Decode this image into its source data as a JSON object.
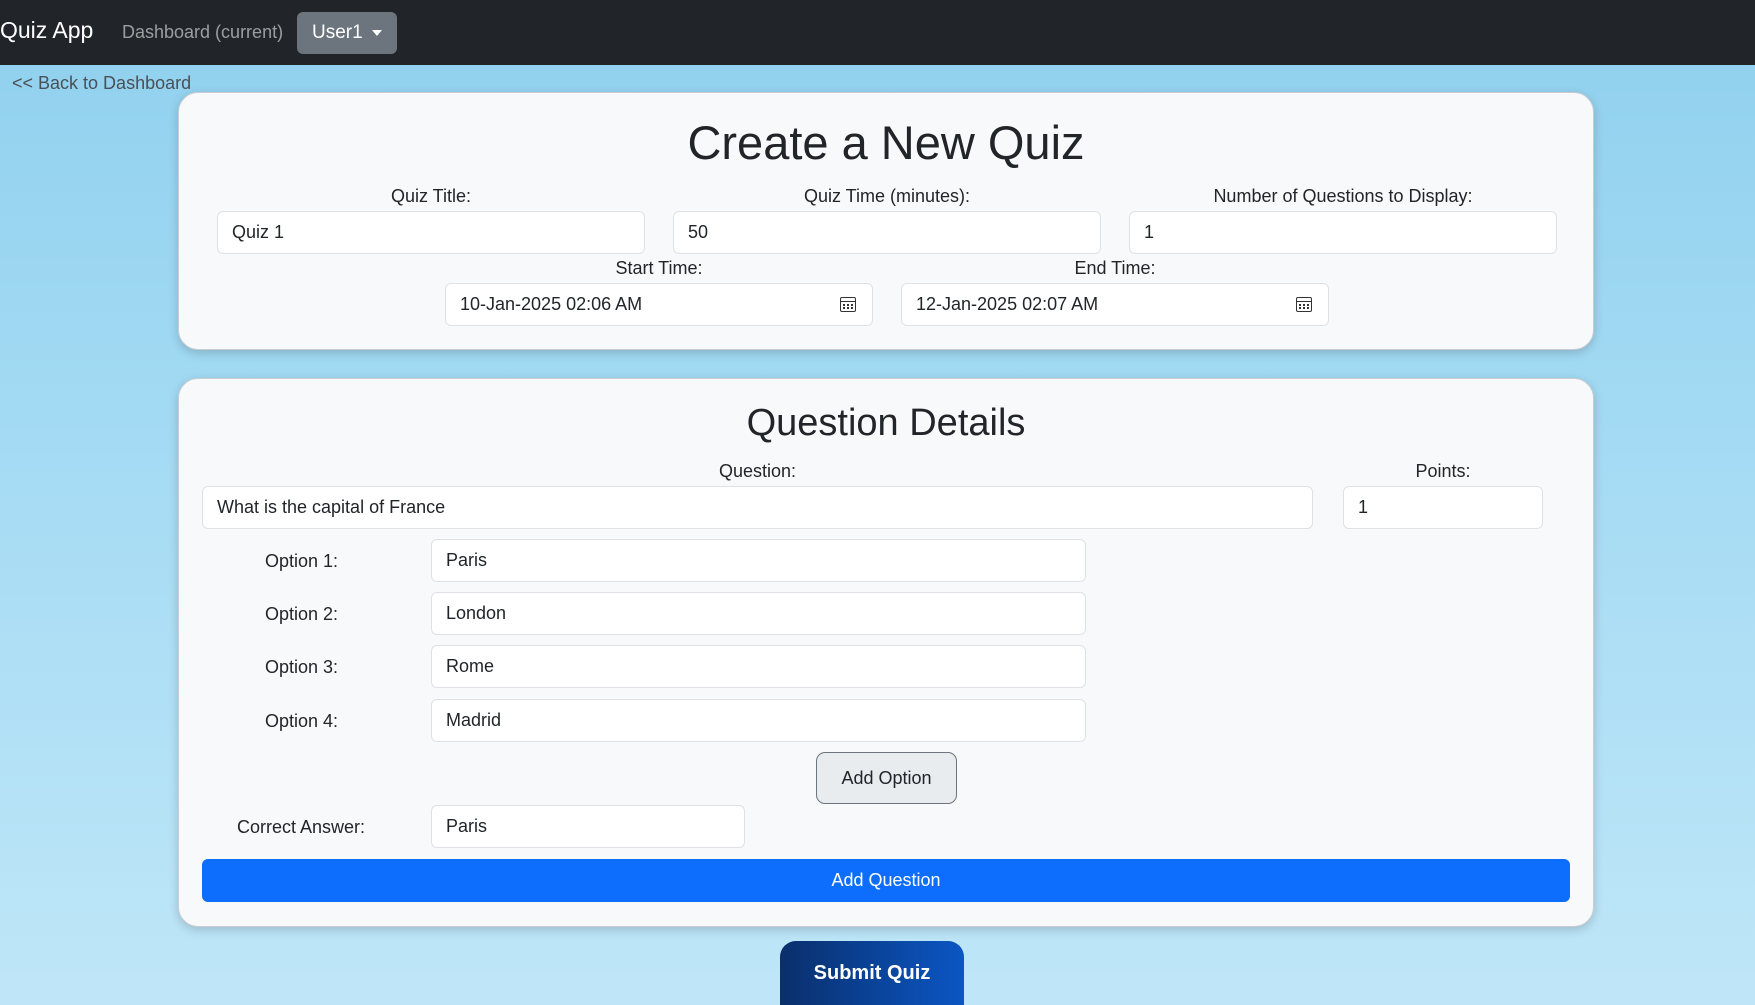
{
  "navbar": {
    "brand": "Quiz App",
    "dashboard_link": "Dashboard (current)",
    "user_menu": "User1"
  },
  "back_link": "<< Back to Dashboard",
  "quiz_form": {
    "title": "Create a New Quiz",
    "quiz_title": {
      "label": "Quiz Title:",
      "value": "Quiz 1"
    },
    "quiz_time": {
      "label": "Quiz Time (minutes):",
      "value": "50"
    },
    "num_questions": {
      "label": "Number of Questions to Display:",
      "value": "1"
    },
    "start_time": {
      "label": "Start Time:",
      "value": "10-Jan-2025 02:06  AM"
    },
    "end_time": {
      "label": "End Time:",
      "value": "12-Jan-2025 02:07  AM"
    }
  },
  "question_form": {
    "title": "Question Details",
    "question": {
      "label": "Question:",
      "value": "What is the capital of France"
    },
    "points": {
      "label": "Points:",
      "value": "1"
    },
    "options": [
      {
        "label": "Option 1:",
        "value": "Paris"
      },
      {
        "label": "Option 2:",
        "value": "London"
      },
      {
        "label": "Option 3:",
        "value": "Rome"
      },
      {
        "label": "Option 4:",
        "value": "Madrid"
      }
    ],
    "add_option_label": "Add Option",
    "correct_answer": {
      "label": "Correct Answer:",
      "value": "Paris"
    },
    "add_question_label": "Add Question"
  },
  "submit_label": "Submit Quiz",
  "colors": {
    "navbar": "#212529",
    "primary": "#0d6efd",
    "submit_start": "#0a2f6b",
    "submit_end": "#0b56c4",
    "card_bg": "#f8f9fa"
  },
  "icons": {
    "start_time": "calendar-icon",
    "end_time": "calendar-icon",
    "user_menu": "caret-down-icon"
  }
}
